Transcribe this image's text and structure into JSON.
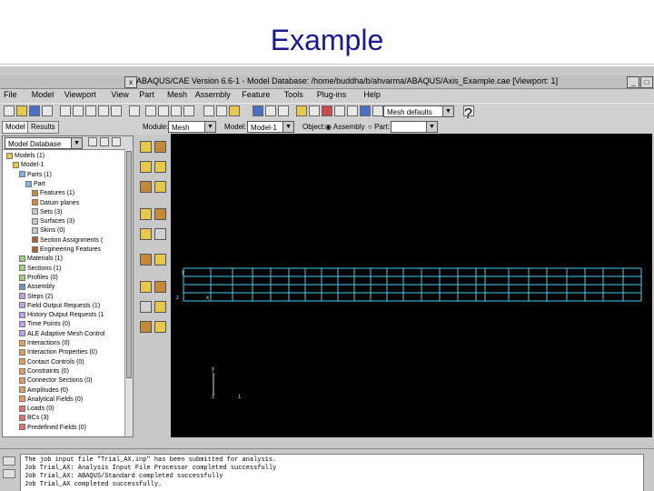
{
  "slide": {
    "title": "Example"
  },
  "window": {
    "title": "ABAQUS/CAE Version 6.6-1 - Model Database: /home/buddha/b/ahvarma/ABAQUS/Axis_Example.cae [Viewport: 1]",
    "close_glyph": "x",
    "min_glyph": "_",
    "max_glyph": "□"
  },
  "menubar": [
    "File",
    "Model",
    "Viewport",
    "View",
    "Part",
    "Mesh",
    "Assembly",
    "Feature",
    "Tools",
    "Plug-ins",
    "Help"
  ],
  "toolbar": {
    "view_select": "Mesh defaults",
    "help_glyph": "?"
  },
  "context": {
    "tabs": [
      "Model",
      "Results"
    ],
    "module_label": "Module:",
    "module_value": "Mesh",
    "model_label": "Model:",
    "model_value": "Model-1",
    "object_label": "Object:",
    "object_assembly": "Assembly",
    "object_part": "Part:"
  },
  "tree": {
    "header": "Model Database",
    "rows": [
      {
        "indent": 0,
        "label": "Models (1)",
        "icon": "folder"
      },
      {
        "indent": 1,
        "label": "Model-1",
        "icon": "folder"
      },
      {
        "indent": 2,
        "label": "Parts (1)",
        "icon": "part"
      },
      {
        "indent": 3,
        "label": "Part",
        "icon": "part"
      },
      {
        "indent": 4,
        "label": "Features (1)",
        "icon": "feature"
      },
      {
        "indent": 4,
        "label": "Datum planes",
        "icon": "feature"
      },
      {
        "indent": 4,
        "label": "Sets (3)",
        "icon": "set"
      },
      {
        "indent": 4,
        "label": "Surfaces (3)",
        "icon": "set"
      },
      {
        "indent": 4,
        "label": "Skins (0)",
        "icon": "set"
      },
      {
        "indent": 4,
        "label": "Section Assignments (",
        "icon": "section"
      },
      {
        "indent": 4,
        "label": "Engineering Features",
        "icon": "section"
      },
      {
        "indent": 2,
        "label": "Materials (1)",
        "icon": "material"
      },
      {
        "indent": 2,
        "label": "Sections (1)",
        "icon": "material"
      },
      {
        "indent": 2,
        "label": "Profiles (0)",
        "icon": "material"
      },
      {
        "indent": 2,
        "label": "Assembly",
        "icon": "assembly"
      },
      {
        "indent": 2,
        "label": "Steps (2)",
        "icon": "step"
      },
      {
        "indent": 2,
        "label": "Field Output Requests (1)",
        "icon": "step"
      },
      {
        "indent": 2,
        "label": "History Output Requests (1",
        "icon": "step"
      },
      {
        "indent": 2,
        "label": "Time Points (0)",
        "icon": "step"
      },
      {
        "indent": 2,
        "label": "ALE Adaptive Mesh Control",
        "icon": "step"
      },
      {
        "indent": 2,
        "label": "Interactions (0)",
        "icon": "interaction"
      },
      {
        "indent": 2,
        "label": "Interaction Properties (0)",
        "icon": "interaction"
      },
      {
        "indent": 2,
        "label": "Contact Controls (0)",
        "icon": "interaction"
      },
      {
        "indent": 2,
        "label": "Constraints (0)",
        "icon": "interaction"
      },
      {
        "indent": 2,
        "label": "Connector Sections (0)",
        "icon": "interaction"
      },
      {
        "indent": 2,
        "label": "Amplitudes (0)",
        "icon": "interaction"
      },
      {
        "indent": 2,
        "label": "Analytical Fields (0)",
        "icon": "interaction"
      },
      {
        "indent": 2,
        "label": "Loads (0)",
        "icon": "load"
      },
      {
        "indent": 2,
        "label": "BCs (3)",
        "icon": "load"
      },
      {
        "indent": 2,
        "label": "Predefined Fields (0)",
        "icon": "load"
      }
    ]
  },
  "viewport": {
    "triad": {
      "y_label": "y",
      "z_label": "z",
      "one_label": "1"
    },
    "axis_labels": {
      "y": "y",
      "z": "z",
      "x": "x"
    },
    "mesh_color": "#40d0f0"
  },
  "messages": [
    "The job input file \"Trial_AX.inp\" has been submitted for analysis.",
    "Job Trial_AX: Analysis Input File Processor completed successfully",
    "Job Trial_AX: ABAQUS/Standard completed successfully",
    "Job Trial_AX completed successfully."
  ]
}
